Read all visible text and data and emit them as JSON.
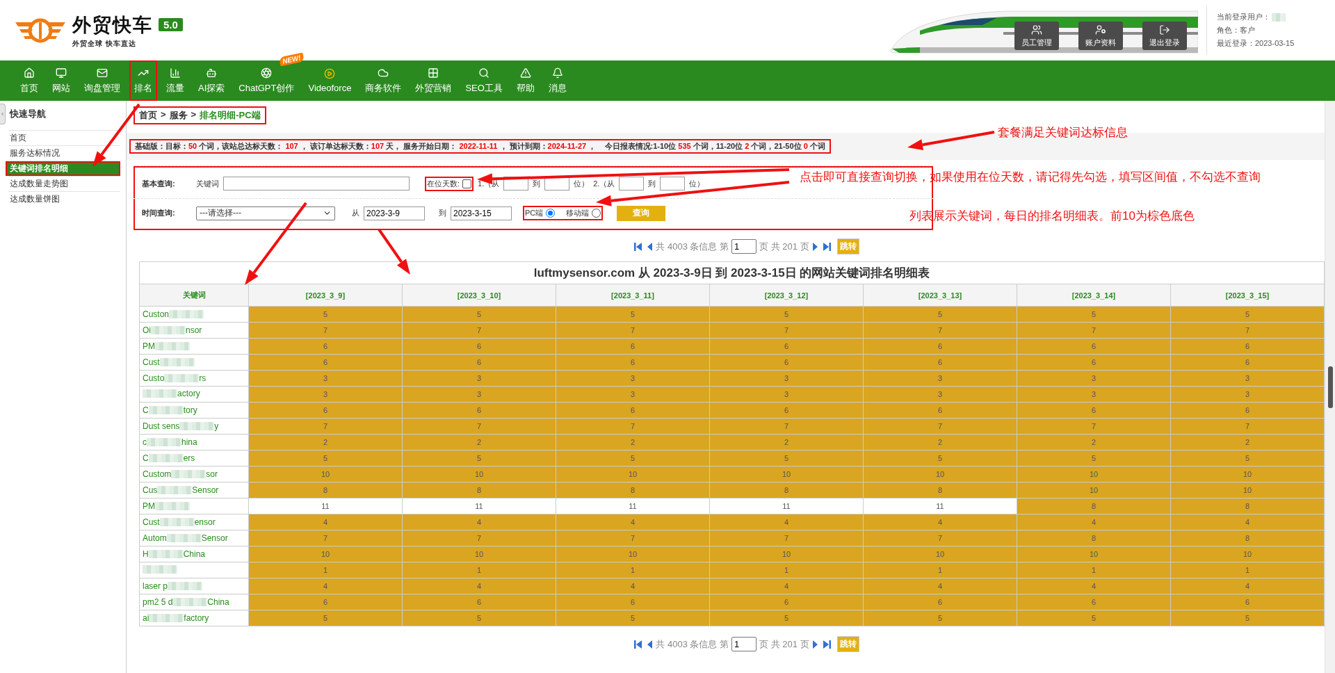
{
  "header": {
    "logo": {
      "title": "外贸快车",
      "version": "5.0",
      "slogan": "外贸全球 快车直达"
    },
    "tools": [
      {
        "label": "员工管理"
      },
      {
        "label": "账户资料"
      },
      {
        "label": "退出登录"
      }
    ],
    "user": {
      "login_label": "当前登录用户：",
      "role": "角色：客户",
      "last_login": "最近登录：2023-03-15"
    }
  },
  "nav": [
    {
      "label": "首页",
      "annotated": false
    },
    {
      "label": "网站",
      "annotated": false
    },
    {
      "label": "询盘管理",
      "annotated": false
    },
    {
      "label": "排名",
      "annotated": true
    },
    {
      "label": "流量",
      "annotated": false
    },
    {
      "label": "AI探索",
      "annotated": false
    },
    {
      "label": "ChatGPT创作",
      "annotated": false,
      "badge": "NEW!"
    },
    {
      "label": "Videoforce",
      "annotated": false
    },
    {
      "label": "商务软件",
      "annotated": false
    },
    {
      "label": "外贸营销",
      "annotated": false
    },
    {
      "label": "SEO工具",
      "annotated": false
    },
    {
      "label": "帮助",
      "annotated": false
    },
    {
      "label": "消息",
      "annotated": false
    }
  ],
  "sidebar": {
    "title": "快速导航",
    "items": [
      {
        "label": "首页",
        "selected": false
      },
      {
        "label": "服务达标情况",
        "selected": false
      },
      {
        "label": "关键词排名明细",
        "selected": true
      },
      {
        "label": "达成数量走势图",
        "selected": false
      },
      {
        "label": "达成数量饼图",
        "selected": false
      }
    ]
  },
  "breadcrumb": {
    "annotated": true,
    "items": [
      "首页",
      "服务"
    ],
    "separator": ">",
    "current": "排名明细-PC端"
  },
  "info": {
    "annotated": true,
    "text": "基础版：目标：**50** 个词，该站总达标天数： **107** ， 该订单达标天数：**107** 天， 服务开始日期： **2022-11-11** ， 预计到期：**2024-11-27** ，    今日报表情况:1-10位 **535** 个词，11-20位 **2** 个词，21-50位 **0** 个词"
  },
  "query": {
    "annotated": true,
    "basic_label": "基本查询:",
    "keyword_label": "关键词",
    "days": {
      "annotated": true,
      "label": "在位天数:",
      "checked": false,
      "ranges": [
        {
          "prefix": "1.（从",
          "to": "到",
          "suffix": "位）"
        },
        {
          "prefix": "2.（从",
          "to": "到",
          "suffix": "位）"
        }
      ]
    },
    "time_label": "时间查询:",
    "select": "---请选择---",
    "from_label": "从",
    "from": "2023-3-9",
    "to_label": "到",
    "to": "2023-3-15",
    "platform": {
      "annotated": true,
      "options": [
        {
          "label": "PC端",
          "selected": true
        },
        {
          "label": "移动端",
          "selected": false
        }
      ]
    },
    "submit": "查询"
  },
  "paginations": [
    {
      "total": "共 4003 条信息 第",
      "page": "1",
      "pages": "页 共 201 页",
      "go": "跳转"
    },
    {
      "total": "共 4003 条信息 第",
      "page": "1",
      "pages": "页 共 201 页",
      "go": "跳转"
    }
  ],
  "table": {
    "title": "luftmysensor.com 从 2023-3-9日 到 2023-3-15日 的网站关键词排名明细表",
    "columns": [
      "关键词",
      "[2023_3_9]",
      "[2023_3_10]",
      "[2023_3_11]",
      "[2023_3_12]",
      "[2023_3_13]",
      "[2023_3_14]",
      "[2023_3_15]"
    ],
    "rows": [
      {
        "keyword_start": "Custon",
        "ranks": [
          "5",
          "5",
          "5",
          "5",
          "5",
          "5",
          "5"
        ]
      },
      {
        "keyword_start": "Oi",
        "keyword_end": "nsor",
        "ranks": [
          "7",
          "7",
          "7",
          "7",
          "7",
          "7",
          "7"
        ]
      },
      {
        "keyword_start": "PM",
        "ranks": [
          "6",
          "6",
          "6",
          "6",
          "6",
          "6",
          "6"
        ]
      },
      {
        "keyword_start": "Cust",
        "ranks": [
          "6",
          "6",
          "6",
          "6",
          "6",
          "6",
          "6"
        ]
      },
      {
        "keyword_start": "Custo",
        "keyword_end": "rs",
        "ranks": [
          "3",
          "3",
          "3",
          "3",
          "3",
          "3",
          "3"
        ]
      },
      {
        "keyword_end": "actory",
        "ranks": [
          "3",
          "3",
          "3",
          "3",
          "3",
          "3",
          "3"
        ]
      },
      {
        "keyword_start": "C",
        "keyword_end": "tory",
        "ranks": [
          "6",
          "6",
          "6",
          "6",
          "6",
          "6",
          "6"
        ]
      },
      {
        "keyword_start": "Dust sens",
        "keyword_end": "y",
        "ranks": [
          "7",
          "7",
          "7",
          "7",
          "7",
          "7",
          "7"
        ]
      },
      {
        "keyword_start": "c",
        "keyword_end": "hina",
        "ranks": [
          "2",
          "2",
          "2",
          "2",
          "2",
          "2",
          "2"
        ]
      },
      {
        "keyword_start": "C",
        "keyword_end": "ers",
        "ranks": [
          "5",
          "5",
          "5",
          "5",
          "5",
          "5",
          "5"
        ]
      },
      {
        "keyword_start": "Custom",
        "keyword_end": "sor",
        "ranks": [
          "10",
          "10",
          "10",
          "10",
          "10",
          "10",
          "10"
        ]
      },
      {
        "keyword_start": "Cus",
        "keyword_end": "Sensor",
        "ranks": [
          "8",
          "8",
          "8",
          "8",
          "8",
          "10",
          "10"
        ]
      },
      {
        "keyword_start": "PM",
        "ranks": [
          "11",
          "11",
          "11",
          "11",
          "11",
          "8",
          "8"
        ]
      },
      {
        "keyword_start": "Cust",
        "keyword_end": "ensor",
        "ranks": [
          "4",
          "4",
          "4",
          "4",
          "4",
          "4",
          "4"
        ]
      },
      {
        "keyword_start": "Autom",
        "keyword_end": "Sensor",
        "ranks": [
          "7",
          "7",
          "7",
          "7",
          "7",
          "8",
          "8"
        ]
      },
      {
        "keyword_start": "H",
        "keyword_end": "China",
        "ranks": [
          "10",
          "10",
          "10",
          "10",
          "10",
          "10",
          "10"
        ]
      },
      {
        "ranks": [
          "1",
          "1",
          "1",
          "1",
          "1",
          "1",
          "1"
        ]
      },
      {
        "keyword_start": "laser p",
        "ranks": [
          "4",
          "4",
          "4",
          "4",
          "4",
          "4",
          "4"
        ]
      },
      {
        "keyword_start": "pm2 5 d",
        "keyword_end": "China",
        "ranks": [
          "6",
          "6",
          "6",
          "6",
          "6",
          "6",
          "6"
        ]
      },
      {
        "keyword_start": "ai",
        "keyword_end": "factory",
        "ranks": [
          "5",
          "5",
          "5",
          "5",
          "5",
          "5",
          "5"
        ]
      }
    ]
  },
  "annotations": [
    {
      "text": "套餐满足关键词达标信息"
    },
    {
      "text": "点击即可直接查询切换，如果使用在位天数，请记得先勾选，填写区间值，不勾选不查询"
    },
    {
      "text": "列表展示关键词，每日的排名明细表。前10为棕色底色"
    }
  ]
}
